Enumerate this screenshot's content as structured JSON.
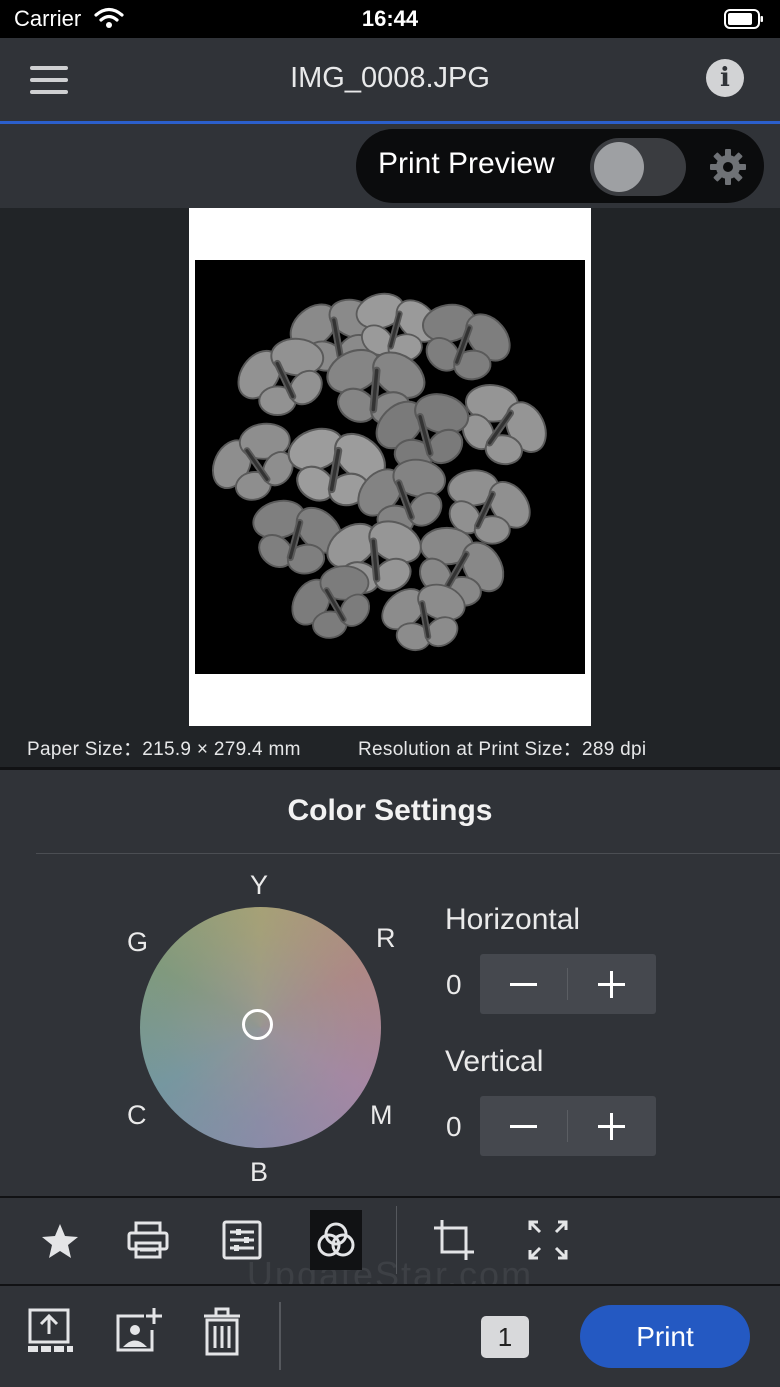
{
  "status_bar": {
    "carrier": "Carrier",
    "time": "16:44"
  },
  "header": {
    "title": "IMG_0008.JPG",
    "info_icon": "info-icon",
    "menu_icon": "hamburger-menu-icon"
  },
  "preview_toggle": {
    "label": "Print Preview",
    "enabled": false
  },
  "preview": {
    "paper_size_text": "Paper Size：215.9 × 279.4 mm",
    "resolution_text": "Resolution at Print Size：289 dpi"
  },
  "color_settings": {
    "title": "Color Settings",
    "wheel_labels": {
      "Y": "Y",
      "R": "R",
      "M": "M",
      "B": "B",
      "C": "C",
      "G": "G"
    },
    "horizontal": {
      "label": "Horizontal",
      "value": "0"
    },
    "vertical": {
      "label": "Vertical",
      "value": "0"
    }
  },
  "toolbar": {
    "tools": [
      "star-icon",
      "printer-icon",
      "settings-list-icon",
      "color-adjust-icon",
      "crop-icon",
      "fit-expand-icon"
    ],
    "selected": "color-adjust-icon"
  },
  "watermark": "UpdateStar.com",
  "actions": {
    "copies": "1",
    "print_label": "Print",
    "icons": [
      "upload-layout-icon",
      "add-photo-icon",
      "trash-icon"
    ]
  },
  "colors": {
    "accent": "#2459c2",
    "background": "#212427",
    "panel": "#303338"
  }
}
